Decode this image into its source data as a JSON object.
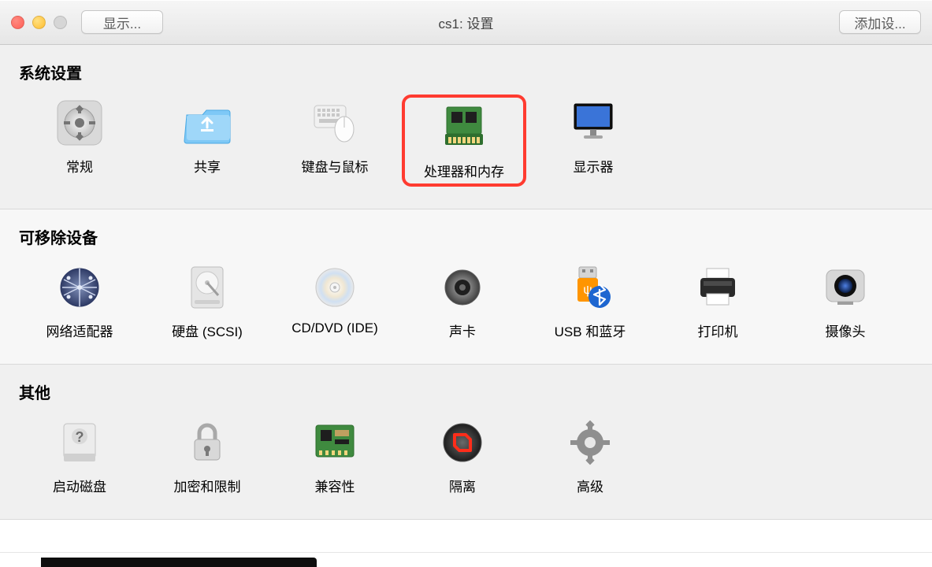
{
  "titlebar": {
    "title": "cs1: 设置",
    "show_button": "显示...",
    "add_device_button": "添加设..."
  },
  "sections": {
    "system": {
      "heading": "系统设置"
    },
    "removable": {
      "heading": "可移除设备"
    },
    "other": {
      "heading": "其他"
    }
  },
  "items": {
    "general": "常规",
    "sharing": "共享",
    "keyboard_mouse": "键盘与鼠标",
    "cpu_memory": "处理器和内存",
    "display": "显示器",
    "network_adapter": "网络适配器",
    "hard_disk": "硬盘 (SCSI)",
    "cd_dvd": "CD/DVD (IDE)",
    "sound": "声卡",
    "usb_bluetooth": "USB 和蓝牙",
    "printer": "打印机",
    "camera": "摄像头",
    "boot_disk": "启动磁盘",
    "encryption": "加密和限制",
    "compatibility": "兼容性",
    "isolation": "隔离",
    "advanced": "高级"
  },
  "highlighted_item": "cpu_memory"
}
